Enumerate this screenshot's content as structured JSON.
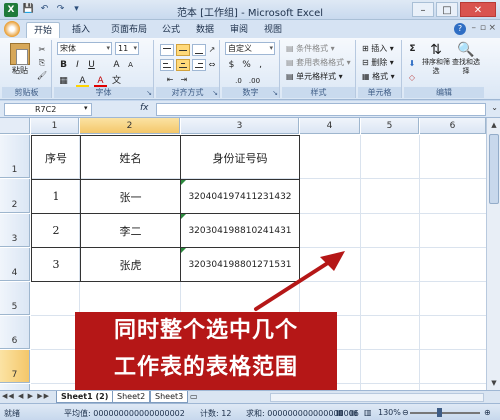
{
  "window": {
    "title": "范本 [工作组] - Microsoft Excel",
    "app_logo": "X",
    "qat": [
      "💾",
      "↶",
      "↷",
      "▾"
    ],
    "controls": {
      "minimize": "–",
      "maximize": "□",
      "close": "✕"
    }
  },
  "ribbon_tabs": [
    "开始",
    "插入",
    "页面布局",
    "公式",
    "数据",
    "审阅",
    "视图"
  ],
  "ribbon_tab_controls": {
    "minimize": "–",
    "restore": "▫",
    "close": "×"
  },
  "ribbon": {
    "clipboard": {
      "paste": "粘贴",
      "label": "剪贴板"
    },
    "font": {
      "name": "宋体",
      "size": "11",
      "bold": "B",
      "italic": "I",
      "underline": "U",
      "grow": "A",
      "shrink": "A",
      "fill": "A",
      "color": "A",
      "label": "字体"
    },
    "alignment": {
      "label": "对齐方式"
    },
    "number": {
      "format": "自定义",
      "percent": "%",
      "comma": ",",
      "label": "数字"
    },
    "styles": {
      "conditional": "条件格式",
      "table": "套用表格格式",
      "cell": "单元格样式",
      "label": "样式"
    },
    "cells": {
      "insert": "插入",
      "delete": "删除",
      "format": "格式",
      "label": "单元格"
    },
    "editing": {
      "sum": "Σ",
      "sort": "排序和筛选",
      "find": "查找和选择",
      "label": "编辑"
    }
  },
  "formula_bar": {
    "name_box": "R7C2",
    "fx": "fx",
    "value": ""
  },
  "columns": [
    "1",
    "2",
    "3",
    "4",
    "5",
    "6"
  ],
  "rows": [
    "1",
    "2",
    "3",
    "4",
    "5",
    "6",
    "7",
    "8",
    "9"
  ],
  "table": {
    "headers": [
      "序号",
      "姓名",
      "身份证号码"
    ],
    "rows": [
      [
        "1",
        "张一",
        "320404197411231432"
      ],
      [
        "2",
        "李二",
        "320304198810241431"
      ],
      [
        "3",
        "张虎",
        "320304198801271531"
      ]
    ]
  },
  "caption": {
    "line1": "同时整个选中几个",
    "line2": "工作表的表格范围"
  },
  "sheet_tabs": [
    "Sheet1 (2)",
    "Sheet2",
    "Sheet3"
  ],
  "tab_nav": "◀◀ ◀ ▶ ▶▶",
  "status": {
    "mode": "就绪",
    "average": "平均值: 000000000000000002",
    "count": "计数: 12",
    "sum": "求和: 000000000000000006",
    "zoom": "130%"
  },
  "colors": {
    "accent": "#b51717",
    "selected_header": "#f4c76a"
  }
}
